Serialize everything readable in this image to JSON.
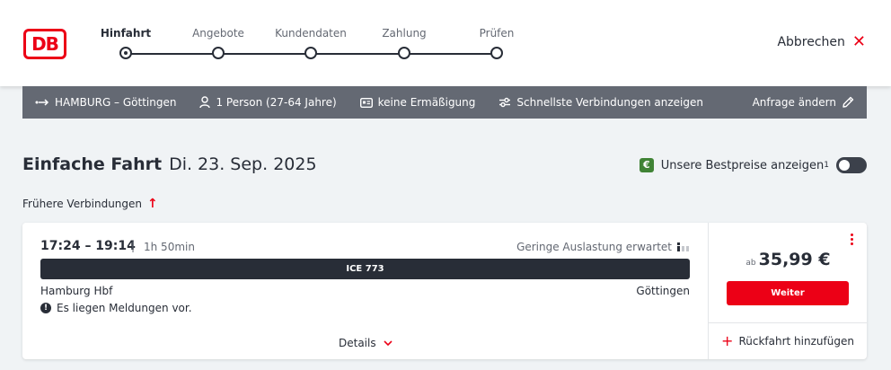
{
  "header": {
    "logo_text": "DB",
    "cancel_label": "Abbrechen",
    "steps": [
      {
        "label": "Hinfahrt",
        "active": true
      },
      {
        "label": "Angebote",
        "active": false
      },
      {
        "label": "Kundendaten",
        "active": false
      },
      {
        "label": "Zahlung",
        "active": false
      },
      {
        "label": "Prüfen",
        "active": false
      }
    ]
  },
  "search_summary": {
    "route": "HAMBURG – Göttingen",
    "passengers": "1 Person (27-64 Jahre)",
    "discount": "keine Ermäßigung",
    "filter": "Schnellste Verbindungen anzeigen",
    "edit_label": "Anfrage ändern"
  },
  "page": {
    "title": "Einfache Fahrt",
    "date": "Di. 23. Sep. 2025",
    "bestprice_label": "Unsere Bestpreise anzeigen",
    "bestprice_footnote": "1",
    "bestprice_badge": "€",
    "earlier_label": "Frühere Verbindungen"
  },
  "connection": {
    "time_range": "17:24 – 19:14",
    "separator": "|",
    "duration": "1h 50min",
    "occupancy": "Geringe Auslastung erwartet",
    "train": "ICE 773",
    "from": "Hamburg Hbf",
    "to": "Göttingen",
    "notice": "Es liegen Meldungen vor.",
    "details_label": "Details",
    "price_prefix": "ab",
    "price": "35,99 €",
    "continue_label": "Weiter",
    "return_label": "Rückfahrt hinzufügen"
  },
  "colors": {
    "accent": "#ec0016",
    "bar": "#646973",
    "dark": "#282d37",
    "green": "#408335"
  }
}
